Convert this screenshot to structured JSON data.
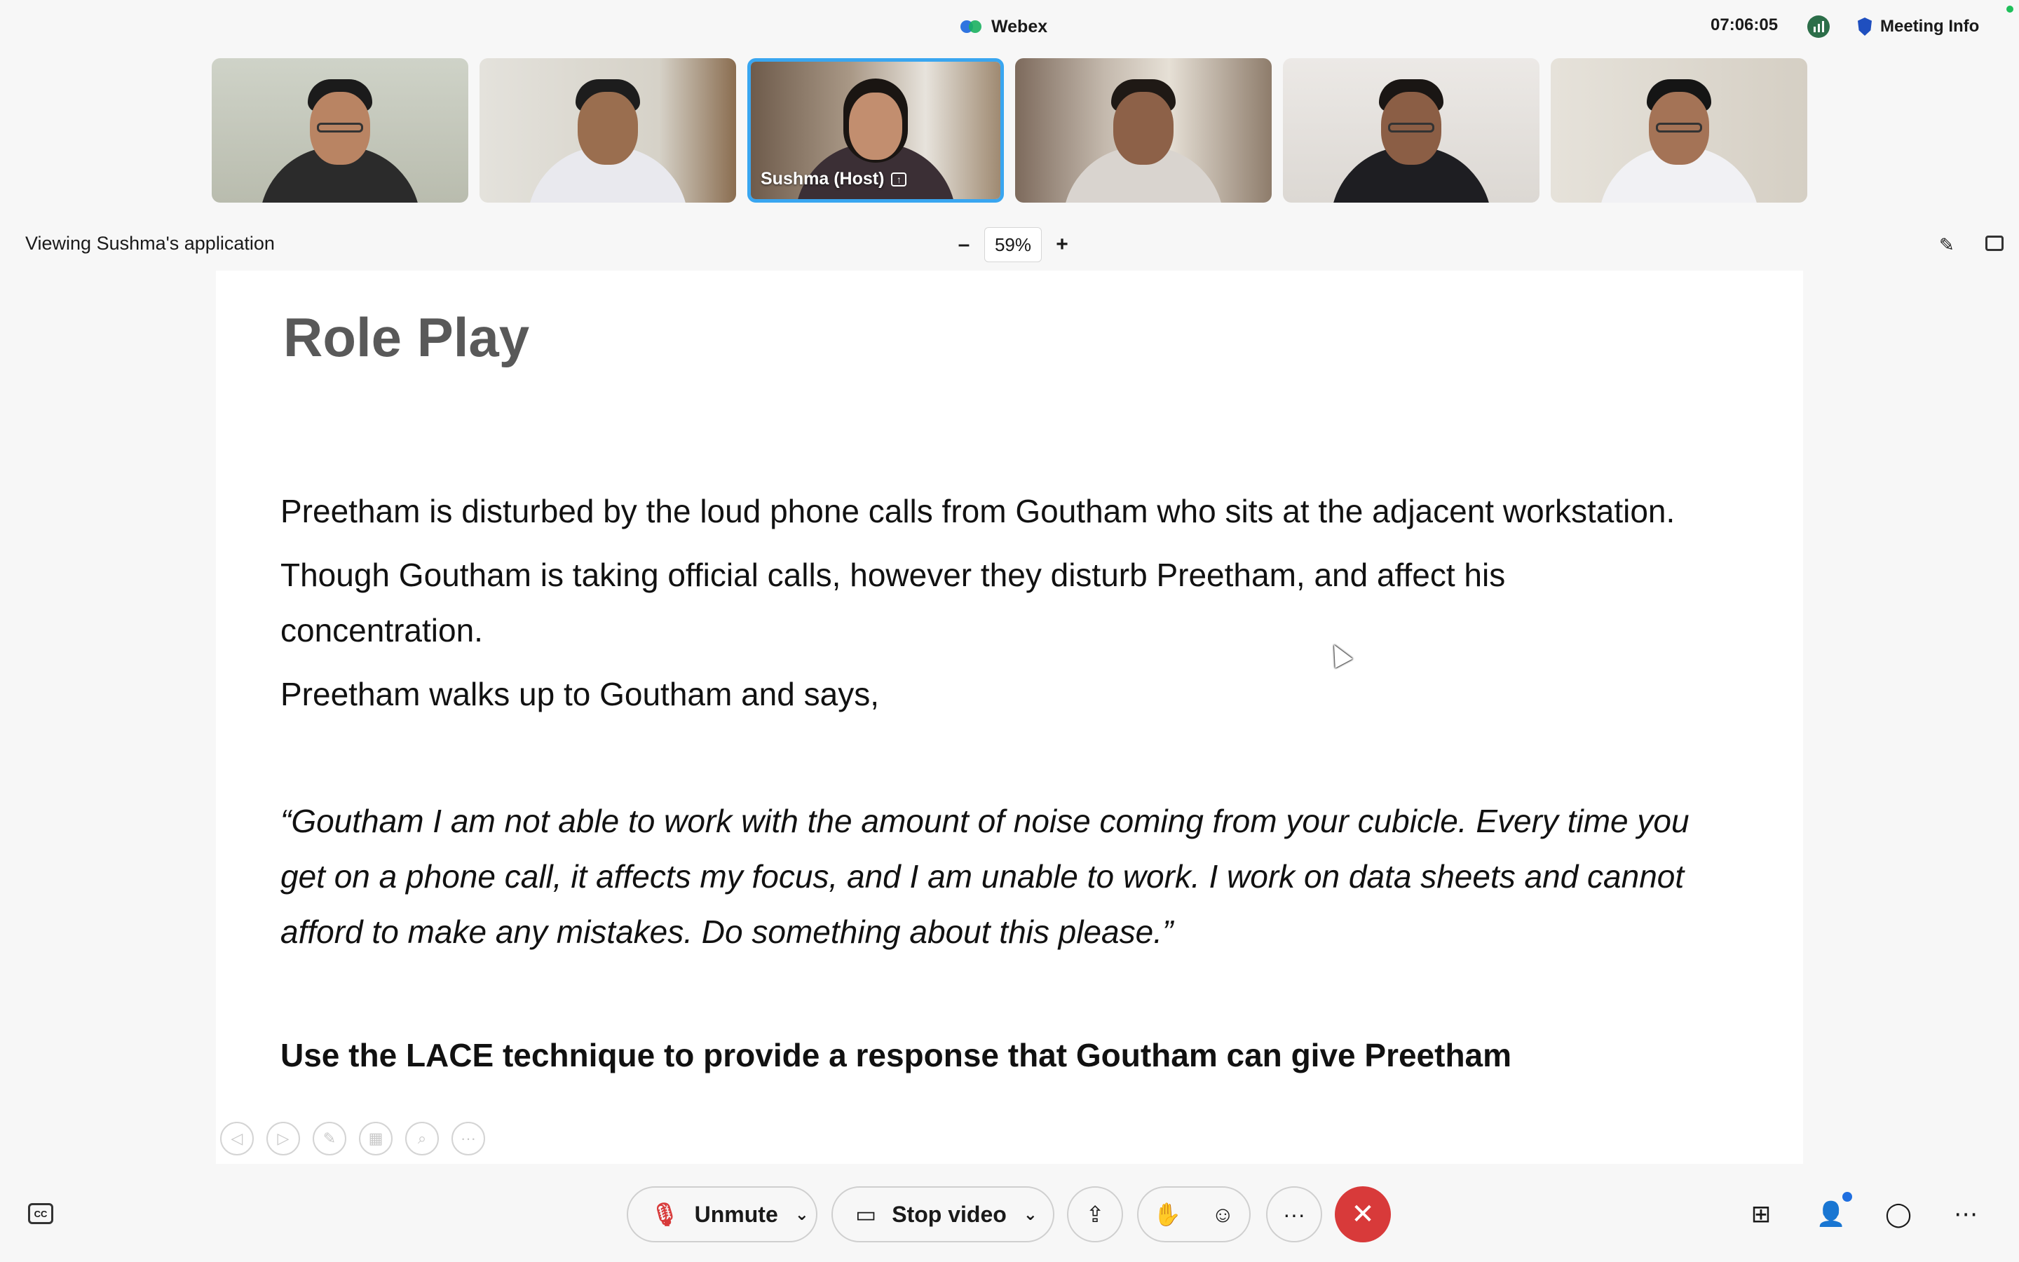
{
  "app": {
    "title": "Webex",
    "clock": "07:06:05",
    "meeting_info_label": "Meeting Info"
  },
  "participants": [
    {
      "name": "",
      "icon": "participant-video"
    },
    {
      "name": "",
      "icon": "participant-video"
    },
    {
      "name": "Sushma  (Host)",
      "icon": "participant-video",
      "active": true,
      "sharing": true
    },
    {
      "name": "",
      "icon": "participant-video"
    },
    {
      "name": "",
      "icon": "participant-video"
    },
    {
      "name": "",
      "icon": "participant-video"
    }
  ],
  "share_bar": {
    "viewing_label": "Viewing Sushma's application",
    "zoom_out": "–",
    "zoom_value": "59%",
    "zoom_in": "+"
  },
  "slide": {
    "title": "Role Play",
    "para1": "Preetham is disturbed by the loud phone calls from Goutham who sits at the adjacent workstation.",
    "para2": "Though Goutham is taking official calls, however they disturb Preetham, and affect his concentration.",
    "para3": "Preetham walks up to Goutham and says,",
    "quote": "“Goutham I am not able to work with the amount of noise coming from your cubicle. Every time you get on a phone call, it affects my focus, and I am unable to work. I work on data sheets and cannot afford to make any mistakes. Do something about this please.”",
    "instruction": "Use the LACE technique to provide a response that Goutham can give Preetham"
  },
  "toolbar": {
    "unmute_label": "Unmute",
    "stop_video_label": "Stop video",
    "more_label": "···"
  },
  "colors": {
    "accent": "#39a6f0",
    "leave": "#d83a3a",
    "notify": "#1f6fe0"
  }
}
